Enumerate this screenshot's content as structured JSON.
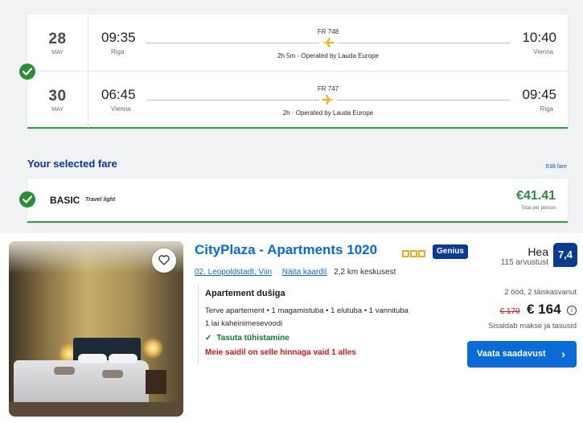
{
  "flights": [
    {
      "day": "28",
      "month": "MAY",
      "dep_time": "09:35",
      "dep_city": "Riga",
      "flight_no": "FR 748",
      "duration": "2h 5m · Operated by Lauda Europe",
      "arr_time": "10:40",
      "arr_city": "Vienna"
    },
    {
      "day": "30",
      "month": "MAY",
      "dep_time": "06:45",
      "dep_city": "Vienna",
      "flight_no": "FR 747",
      "duration": "2h · Operated by Lauda Europe",
      "arr_time": "09:45",
      "arr_city": "Riga"
    }
  ],
  "fare": {
    "title": "Your selected fare",
    "edit_label": "Edit fare",
    "name": "BASIC",
    "tagline": "Travel light",
    "price": "€41.41",
    "price_note": "Total per person"
  },
  "hotel": {
    "name": "CityPlaza - Apartments 1020",
    "star_count": 3,
    "genius_label": "Genius",
    "location_link": "02. Leopoldstadt, Viin",
    "map_link": "Näita kaardil",
    "distance": "2,2 km keskusest",
    "room_title": "Apartement dušiga",
    "room_desc": "Terve apartement • 1 magamistuba • 1 elutuba • 1 vannituba",
    "bed_desc": "1 lai kaheinimesevoodi",
    "cancellation": "Tasuta tühistamine",
    "scarcity": "Meie saidil on selle hinnaga vaid 1 alles",
    "review_word": "Hea",
    "review_count": "115 arvustust",
    "score": "7,4",
    "stay_info": "2 ööd, 2 täiskasvanut",
    "old_price": "€ 179",
    "new_price": "€ 164",
    "tax_note": "Sisaldab makse ja tasusid",
    "cta_label": "Vaata saadavust",
    "icons": {
      "favorite": "heart-outline-icon",
      "check": "checkmark-icon",
      "plane": "plane-icon",
      "info": "info-icon",
      "chevron": "chevron-right-icon"
    }
  },
  "colors": {
    "ryanair_navy": "#073590",
    "ryanair_green": "#2e8b3a",
    "booking_blue": "#0a6bd6",
    "booking_navy": "#0b3b8f",
    "star_gold": "#f3a81e",
    "price_red": "#d0181f",
    "plane_yellow": "#f2b21b"
  }
}
